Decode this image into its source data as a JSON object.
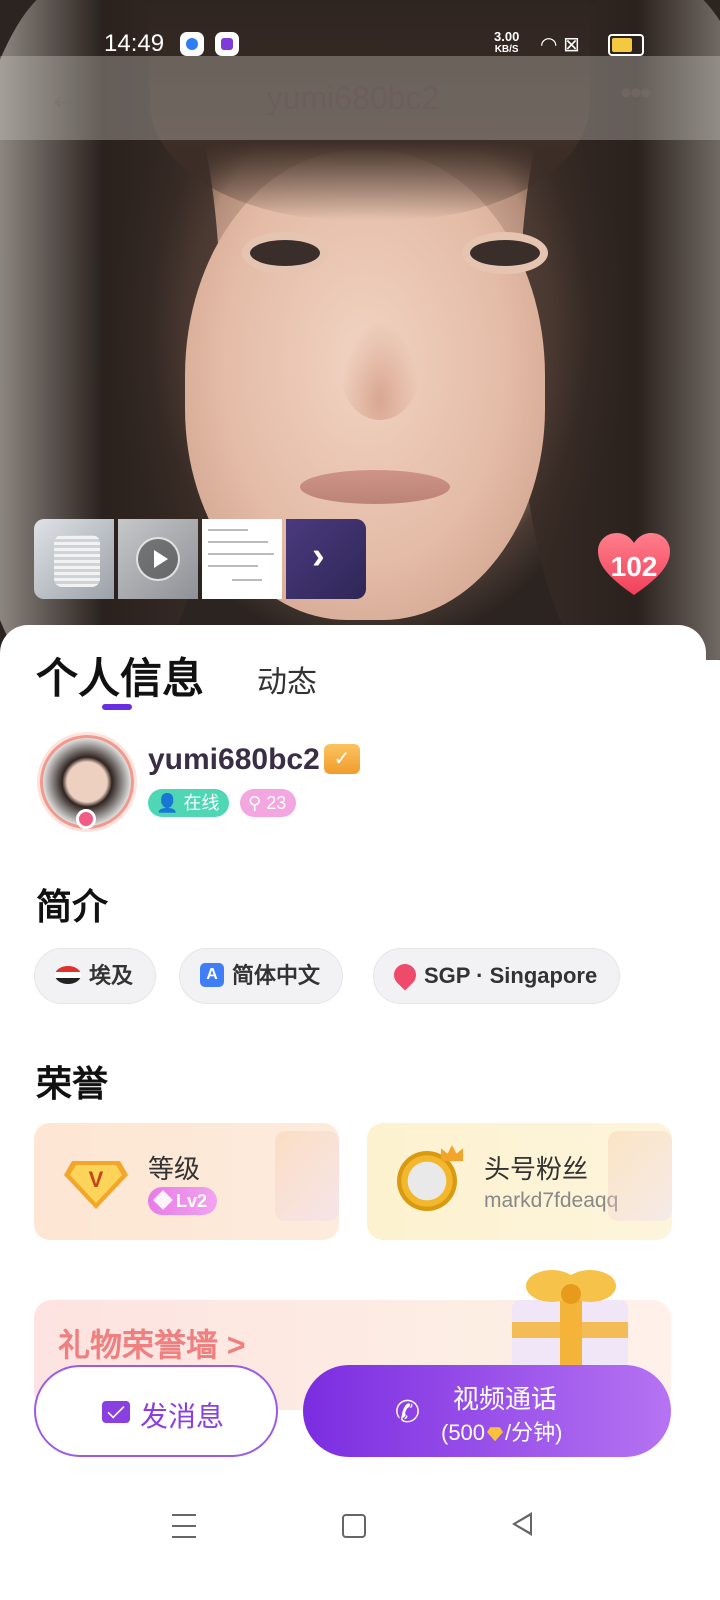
{
  "status_bar": {
    "time": "14:49",
    "net_speed": "3.00",
    "net_unit": "KB/S"
  },
  "header": {
    "title": "yumi680bc2"
  },
  "likes": {
    "count": "102"
  },
  "tabs": [
    {
      "label": "个人信息"
    },
    {
      "label": "动态"
    }
  ],
  "profile": {
    "username": "yumi680bc2",
    "online_label": "在线",
    "fans_count": "23"
  },
  "intro": {
    "title": "简介",
    "chips": [
      {
        "label": "埃及",
        "icon": "egypt-flag-icon"
      },
      {
        "label": "简体中文",
        "icon": "language-icon"
      },
      {
        "label": "SGP · Singapore",
        "icon": "location-pin-icon"
      }
    ]
  },
  "honor": {
    "title": "荣誉",
    "level": {
      "label": "等级",
      "badge": "Lv2"
    },
    "top_fan": {
      "label": "头号粉丝",
      "name": "markd7fdeaqq"
    }
  },
  "gift_wall": {
    "label": "礼物荣誉墙 >"
  },
  "actions": {
    "message": "发消息",
    "call_title": "视频通话",
    "call_price_prefix": "(500",
    "call_price_suffix": "/分钟)"
  }
}
